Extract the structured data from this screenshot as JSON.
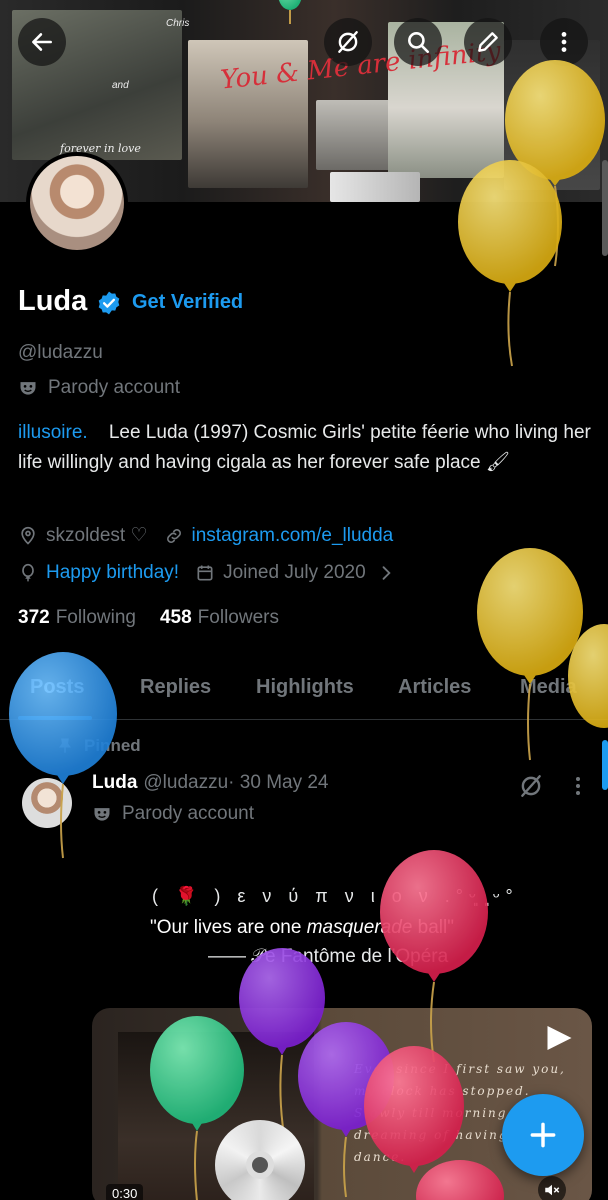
{
  "header": {
    "back_icon": "arrow-left-icon",
    "grok_icon": "grok-icon",
    "search_icon": "search-icon",
    "edit_icon": "pencil-icon",
    "more_icon": "more-vertical-icon",
    "banner_text": {
      "chris": "Chris",
      "and": "and",
      "script": "You & Me are infinity",
      "forever": "forever in love"
    }
  },
  "profile": {
    "name": "Luda",
    "get_verified": "Get Verified",
    "handle": "@ludazzu",
    "parody_label": "Parody account",
    "bio_link": "illusoire.",
    "bio_text": "Lee Luda (1997) Cosmic Girls' petite féerie who living her life willingly and having cigala as her forever safe place 🖌",
    "location": "skzoldest ♡",
    "website": "instagram.com/e_lludda",
    "birthday": "Happy birthday!",
    "joined": "Joined July 2020",
    "following_count": "372",
    "following_label": "Following",
    "followers_count": "458",
    "followers_label": "Followers"
  },
  "tabs": [
    "Posts",
    "Replies",
    "Highlights",
    "Articles",
    "Media"
  ],
  "post": {
    "pinned_label": "Pinned",
    "author": "Luda",
    "handle": "@ludazzu",
    "date": "· 30 May 24",
    "parody_label": "Parody account",
    "line1": "( 🌹 ) ε ν ύ π ν ι ο ν  .°ᵕ͈ ͈ᵕ°",
    "line2_pre": "\"Our lives are one ",
    "line2_em": "masquerade",
    "line2_post": " ball\"",
    "line3": "—— 𝒫e Fantôme de l'Opéra",
    "media_note": "Ever since I first saw you, my clock has stopped. Slowly till morning I'm dreaming of having our last dance.",
    "video_time": "0:30"
  },
  "fab_icon": "plus-icon",
  "colors": {
    "accent": "#1d9bf0",
    "text": "#e7e9ea",
    "muted": "#71767b",
    "background": "#000000"
  }
}
